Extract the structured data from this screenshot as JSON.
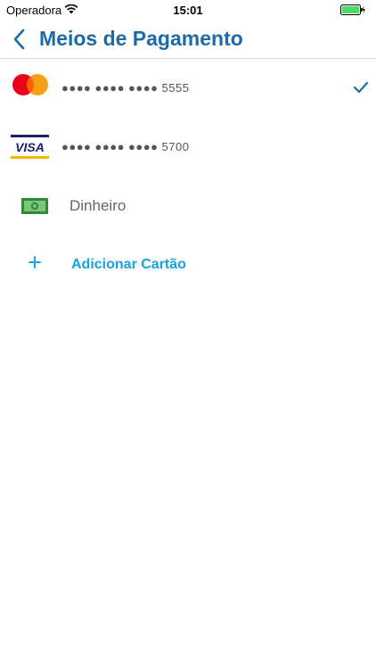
{
  "status_bar": {
    "carrier": "Operadora",
    "time": "15:01",
    "battery_color": "#4cd964"
  },
  "header": {
    "title": "Meios de Pagamento",
    "back_icon": "chevron-left-icon",
    "accent_color": "#1d6aa8"
  },
  "payment_methods": [
    {
      "type": "mastercard",
      "icon": "mastercard-icon",
      "masked_number": "●●●● ●●●● ●●●● 5555",
      "selected": true
    },
    {
      "type": "visa",
      "icon": "visa-icon",
      "visa_text": "VISA",
      "masked_number": "●●●● ●●●● ●●●● 5700",
      "selected": false
    },
    {
      "type": "cash",
      "icon": "cash-icon",
      "label": "Dinheiro",
      "selected": false
    }
  ],
  "add_card": {
    "icon": "plus-icon",
    "label": "Adicionar Cartão",
    "color": "#16a3e3"
  },
  "selected_check_icon": "checkmark-icon"
}
